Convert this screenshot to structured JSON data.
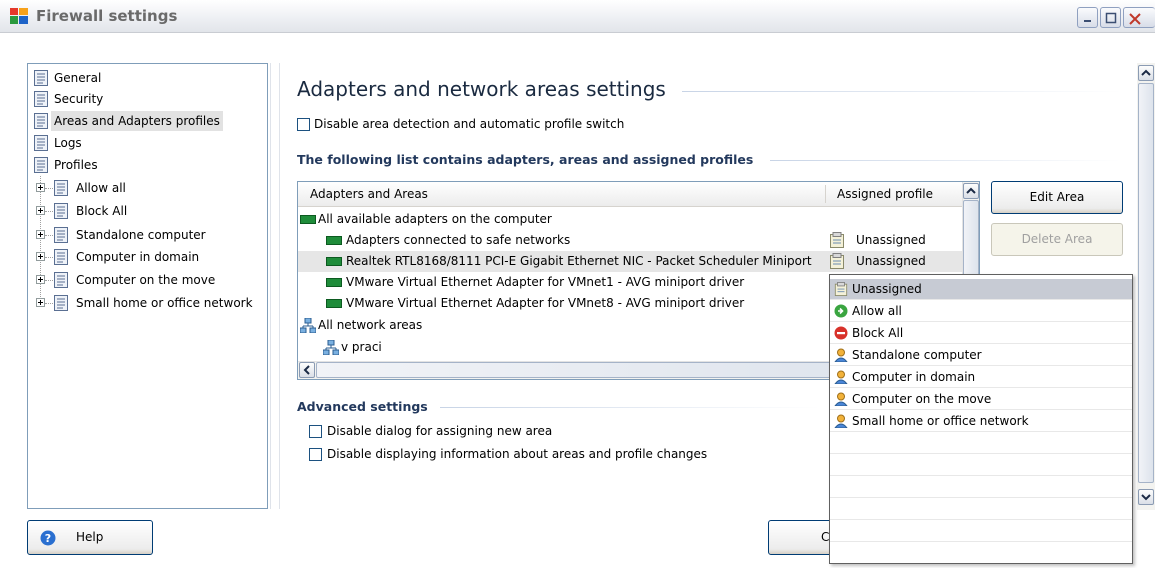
{
  "window": {
    "title": "Firewall settings"
  },
  "tree": {
    "items": [
      {
        "label": "General"
      },
      {
        "label": "Security"
      },
      {
        "label": "Areas and Adapters profiles",
        "selected": true
      },
      {
        "label": "Logs"
      },
      {
        "label": "Profiles"
      }
    ],
    "profiles": [
      {
        "label": "Allow all"
      },
      {
        "label": "Block All"
      },
      {
        "label": "Standalone computer"
      },
      {
        "label": "Computer in domain"
      },
      {
        "label": "Computer on the move"
      },
      {
        "label": "Small home or office network"
      }
    ]
  },
  "main": {
    "heading": "Adapters and network areas settings",
    "disable_detection_label": "Disable area detection and automatic profile switch",
    "list_section_title": "The following list contains adapters, areas and assigned profiles",
    "columns": {
      "name": "Adapters and Areas",
      "profile": "Assigned profile"
    },
    "rows": [
      {
        "name": "All available adapters on the computer",
        "profile": "",
        "icon": "nic-icon"
      },
      {
        "name": "Adapters connected to safe networks",
        "profile": "Unassigned",
        "icon": "nic-icon"
      },
      {
        "name": "Realtek RTL8168/8111 PCI-E Gigabit Ethernet NIC - Packet Scheduler Miniport",
        "profile": "Unassigned",
        "icon": "nic-icon",
        "highlighted": true
      },
      {
        "name": "VMware Virtual Ethernet Adapter for VMnet1 - AVG miniport driver",
        "profile": "",
        "icon": "nic-icon"
      },
      {
        "name": "VMware Virtual Ethernet Adapter for VMnet8 - AVG miniport driver",
        "profile": "",
        "icon": "nic-icon"
      },
      {
        "name": "All network areas",
        "profile": "",
        "icon": "network-icon"
      },
      {
        "name": "v praci",
        "profile": "",
        "icon": "network-icon"
      }
    ],
    "edit_area_label": "Edit Area",
    "delete_area_label": "Delete Area",
    "advanced_title": "Advanced settings",
    "advanced_options": [
      {
        "label": "Disable dialog for assigning new area"
      },
      {
        "label": "Disable displaying information about areas and profile changes"
      }
    ]
  },
  "dropdown": {
    "options": [
      {
        "label": "Unassigned",
        "icon": "unassigned-icon",
        "selected": true
      },
      {
        "label": "Allow all",
        "icon": "allow-icon"
      },
      {
        "label": "Block All",
        "icon": "block-icon"
      },
      {
        "label": "Standalone computer",
        "icon": "user-icon"
      },
      {
        "label": "Computer in domain",
        "icon": "user-icon"
      },
      {
        "label": "Computer on the move",
        "icon": "user-icon"
      },
      {
        "label": "Small home or office network",
        "icon": "user-icon"
      }
    ]
  },
  "footer": {
    "help_label": "Help",
    "partial_button_label": "C"
  },
  "colors": {
    "accent": "#23395d",
    "nic": "#1f8c3a",
    "selected_bg": "#c7cbd4"
  }
}
